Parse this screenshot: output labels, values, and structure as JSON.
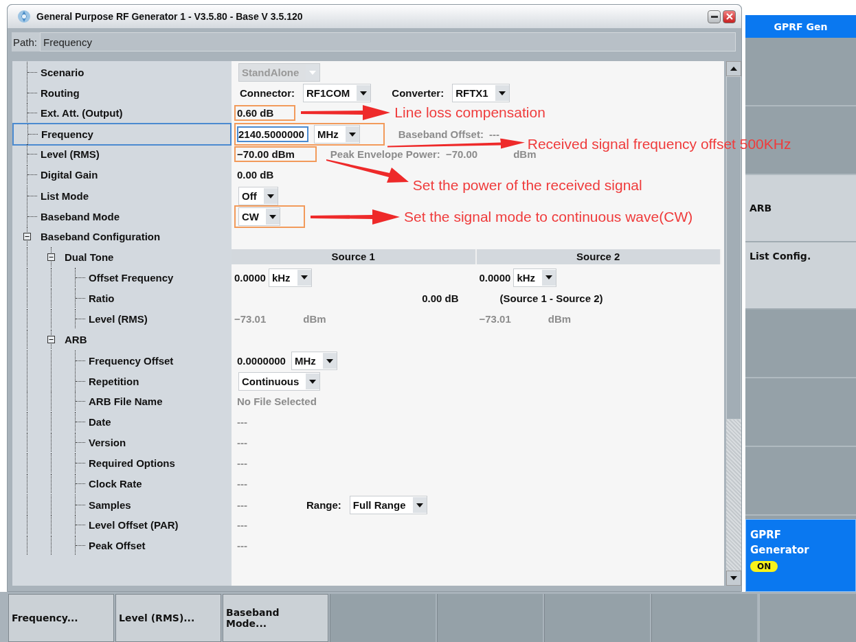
{
  "window": {
    "title": "General Purpose RF Generator 1 - V3.5.80 - Base V 3.5.120"
  },
  "path": {
    "label": "Path:",
    "value": "Frequency"
  },
  "tree": [
    {
      "label": "Scenario",
      "selected": false,
      "kind": "setting",
      "value": [
        {
          "kind": "select",
          "text": "StandAlone",
          "disabled": true
        }
      ]
    },
    {
      "label": "Routing",
      "selected": false,
      "kind": "setting",
      "value": [
        {
          "kind": "label",
          "text": "Connector:"
        },
        {
          "kind": "select",
          "text": "RF1COM",
          "disabled": false
        },
        {
          "kind": "label",
          "text": "Converter:"
        },
        {
          "kind": "select",
          "text": "RFTX1",
          "disabled": false
        }
      ]
    },
    {
      "label": "Ext. Att. (Output)",
      "selected": false,
      "kind": "setting",
      "value": [
        {
          "kind": "text",
          "text": "0.60 dB"
        }
      ],
      "annotation": {
        "text": "Line loss compensation",
        "kind": "straight"
      }
    },
    {
      "label": "Frequency",
      "selected": true,
      "kind": "setting",
      "value": [
        {
          "kind": "field",
          "text": "2140.5000000"
        },
        {
          "kind": "select",
          "text": "MHz",
          "disabled": false
        }
      ],
      "extra": [
        {
          "kind": "dimlabel",
          "text": "Baseband Offset:"
        },
        {
          "kind": "dim",
          "text": "---"
        }
      ],
      "annotation": {
        "text": "Received signal frequency offset 500KHz",
        "kind": "low"
      }
    },
    {
      "label": "Level (RMS)",
      "selected": false,
      "kind": "setting",
      "value": [
        {
          "kind": "text",
          "text": "−70.00 dBm"
        }
      ],
      "extra": [
        {
          "kind": "dimlabel",
          "text": "Peak Envelope Power:"
        },
        {
          "kind": "dim",
          "text": "−70.00"
        },
        {
          "kind": "dimunit",
          "text": "dBm"
        }
      ],
      "annotation": {
        "text": "Set the power of the received signal",
        "kind": "diagonal"
      }
    },
    {
      "label": "Digital Gain",
      "selected": false,
      "kind": "setting",
      "value": [
        {
          "kind": "text",
          "text": "0.00 dB"
        }
      ]
    },
    {
      "label": "List Mode",
      "selected": false,
      "kind": "setting",
      "value": [
        {
          "kind": "select",
          "text": "Off",
          "disabled": false
        }
      ]
    },
    {
      "label": "Baseband Mode",
      "selected": false,
      "kind": "setting",
      "value": [
        {
          "kind": "select",
          "text": "CW",
          "disabled": false
        }
      ],
      "annotation": {
        "text": "Set the signal mode to continuous wave(CW)",
        "kind": "straight"
      }
    },
    {
      "label": "Baseband Configuration",
      "selected": false,
      "kind": "group",
      "expanded": true,
      "children": [
        {
          "label": "Dual Tone",
          "selected": false,
          "kind": "group",
          "expanded": true,
          "header": [
            "Source 1",
            "Source 2"
          ],
          "children": [
            {
              "label": "Offset Frequency",
              "selected": false,
              "kind": "dual",
              "halves": [
                [
                  {
                    "kind": "text",
                    "text": "0.0000"
                  },
                  {
                    "kind": "select",
                    "text": "kHz",
                    "disabled": false
                  }
                ],
                [
                  {
                    "kind": "text",
                    "text": "0.0000"
                  },
                  {
                    "kind": "select",
                    "text": "kHz",
                    "disabled": false
                  }
                ]
              ]
            },
            {
              "label": "Ratio",
              "selected": false,
              "kind": "ratio",
              "halves": [
                [
                  {
                    "kind": "text",
                    "text": "0.00 dB"
                  }
                ],
                [
                  {
                    "kind": "text",
                    "text": "(Source 1 - Source 2)"
                  }
                ]
              ]
            },
            {
              "label": "Level (RMS)",
              "selected": false,
              "kind": "dual",
              "halves": [
                [
                  {
                    "kind": "dim",
                    "text": "−73.01"
                  },
                  {
                    "kind": "dimunit",
                    "text": "dBm"
                  }
                ],
                [
                  {
                    "kind": "dim",
                    "text": "−73.01"
                  },
                  {
                    "kind": "dimunit",
                    "text": "dBm"
                  }
                ]
              ]
            }
          ]
        },
        {
          "label": "ARB",
          "selected": false,
          "kind": "group",
          "expanded": true,
          "children": [
            {
              "label": "Frequency Offset",
              "selected": false,
              "kind": "setting",
              "value": [
                {
                  "kind": "text",
                  "text": "0.0000000"
                },
                {
                  "kind": "select",
                  "text": "MHz",
                  "disabled": false
                }
              ]
            },
            {
              "label": "Repetition",
              "selected": false,
              "kind": "setting",
              "value": [
                {
                  "kind": "select",
                  "text": "Continuous",
                  "disabled": false
                }
              ]
            },
            {
              "label": "ARB File Name",
              "selected": false,
              "kind": "setting",
              "value": [
                {
                  "kind": "dim",
                  "text": "No File Selected"
                }
              ]
            },
            {
              "label": "Date",
              "selected": false,
              "kind": "setting",
              "value": [
                {
                  "kind": "dim",
                  "text": "---"
                }
              ]
            },
            {
              "label": "Version",
              "selected": false,
              "kind": "setting",
              "value": [
                {
                  "kind": "dim",
                  "text": "---"
                }
              ]
            },
            {
              "label": "Required Options",
              "selected": false,
              "kind": "setting",
              "value": [
                {
                  "kind": "dim",
                  "text": "---"
                }
              ]
            },
            {
              "label": "Clock Rate",
              "selected": false,
              "kind": "setting",
              "value": [
                {
                  "kind": "dim",
                  "text": "---"
                }
              ]
            },
            {
              "label": "Samples",
              "selected": false,
              "kind": "setting",
              "value": [
                {
                  "kind": "dim",
                  "text": "---"
                },
                {
                  "kind": "label",
                  "text": "Range:"
                },
                {
                  "kind": "select",
                  "text": "Full Range",
                  "disabled": false
                }
              ]
            },
            {
              "label": "Level Offset (PAR)",
              "selected": false,
              "kind": "setting",
              "value": [
                {
                  "kind": "dim",
                  "text": "---"
                }
              ]
            },
            {
              "label": "Peak Offset",
              "selected": false,
              "kind": "setting",
              "value": [
                {
                  "kind": "dim",
                  "text": "---"
                }
              ]
            }
          ]
        }
      ]
    }
  ],
  "sidebar": {
    "title": "GPRF Gen",
    "keys": [
      "ARB",
      "List Config."
    ],
    "status": {
      "label": "GPRF Generator",
      "state": "ON",
      "on": true
    }
  },
  "softkeys": [
    "Frequency...",
    "Level (RMS)...",
    "Baseband Mode..."
  ]
}
